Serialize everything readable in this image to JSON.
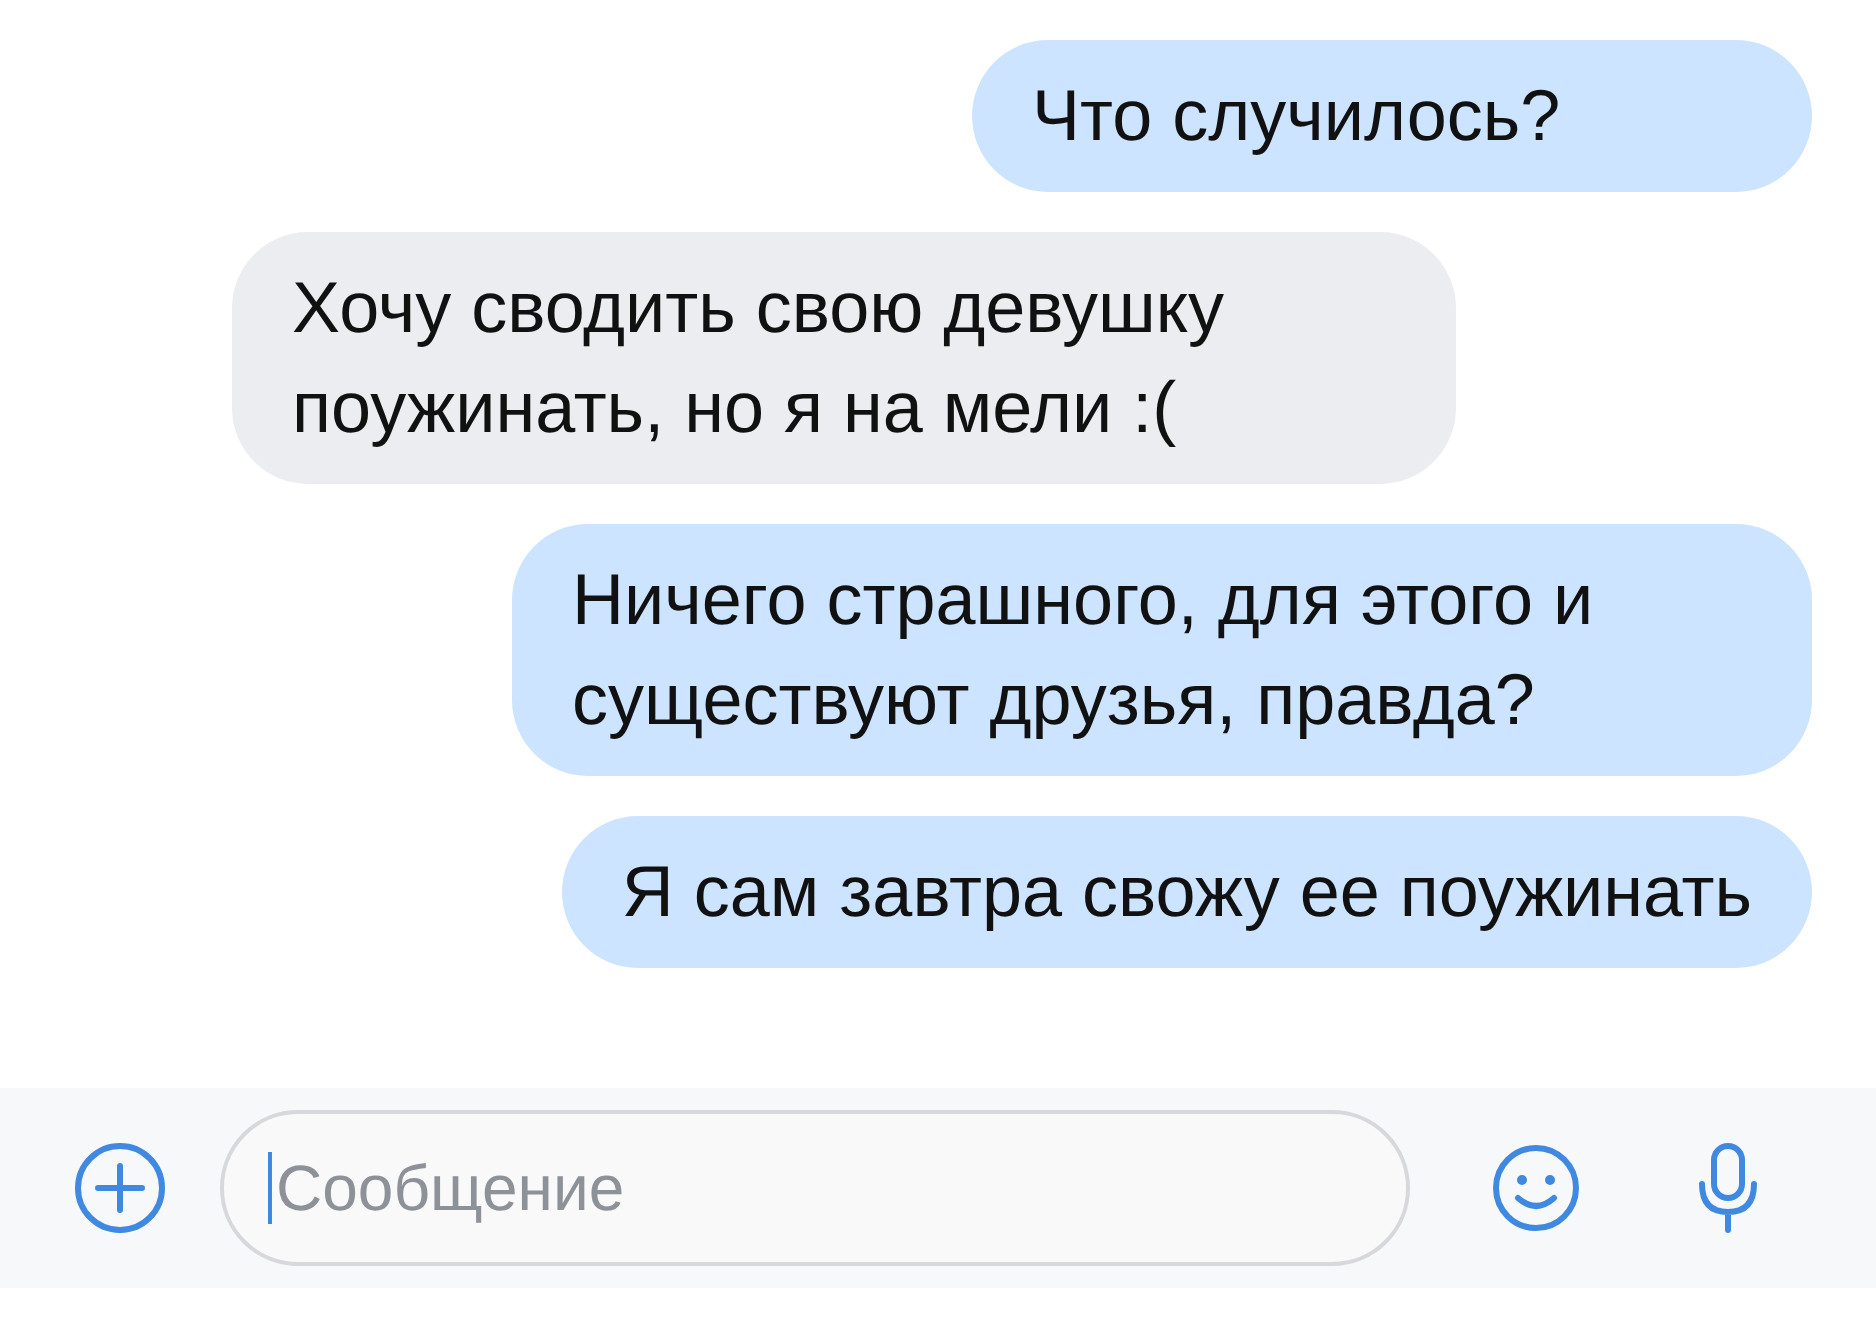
{
  "messages": [
    {
      "kind": "outgoing",
      "text": "Что случилось?"
    },
    {
      "kind": "incoming",
      "text": "Хочу сводить свою девушку поужинать, но я на мели :("
    },
    {
      "kind": "outgoing",
      "text": "Ничего страшного, для этого и существуют друзья, правда?"
    },
    {
      "kind": "outgoing",
      "text": "Я сам завтра свожу ее поужинать"
    }
  ],
  "composer": {
    "placeholder": "Сообщение"
  }
}
